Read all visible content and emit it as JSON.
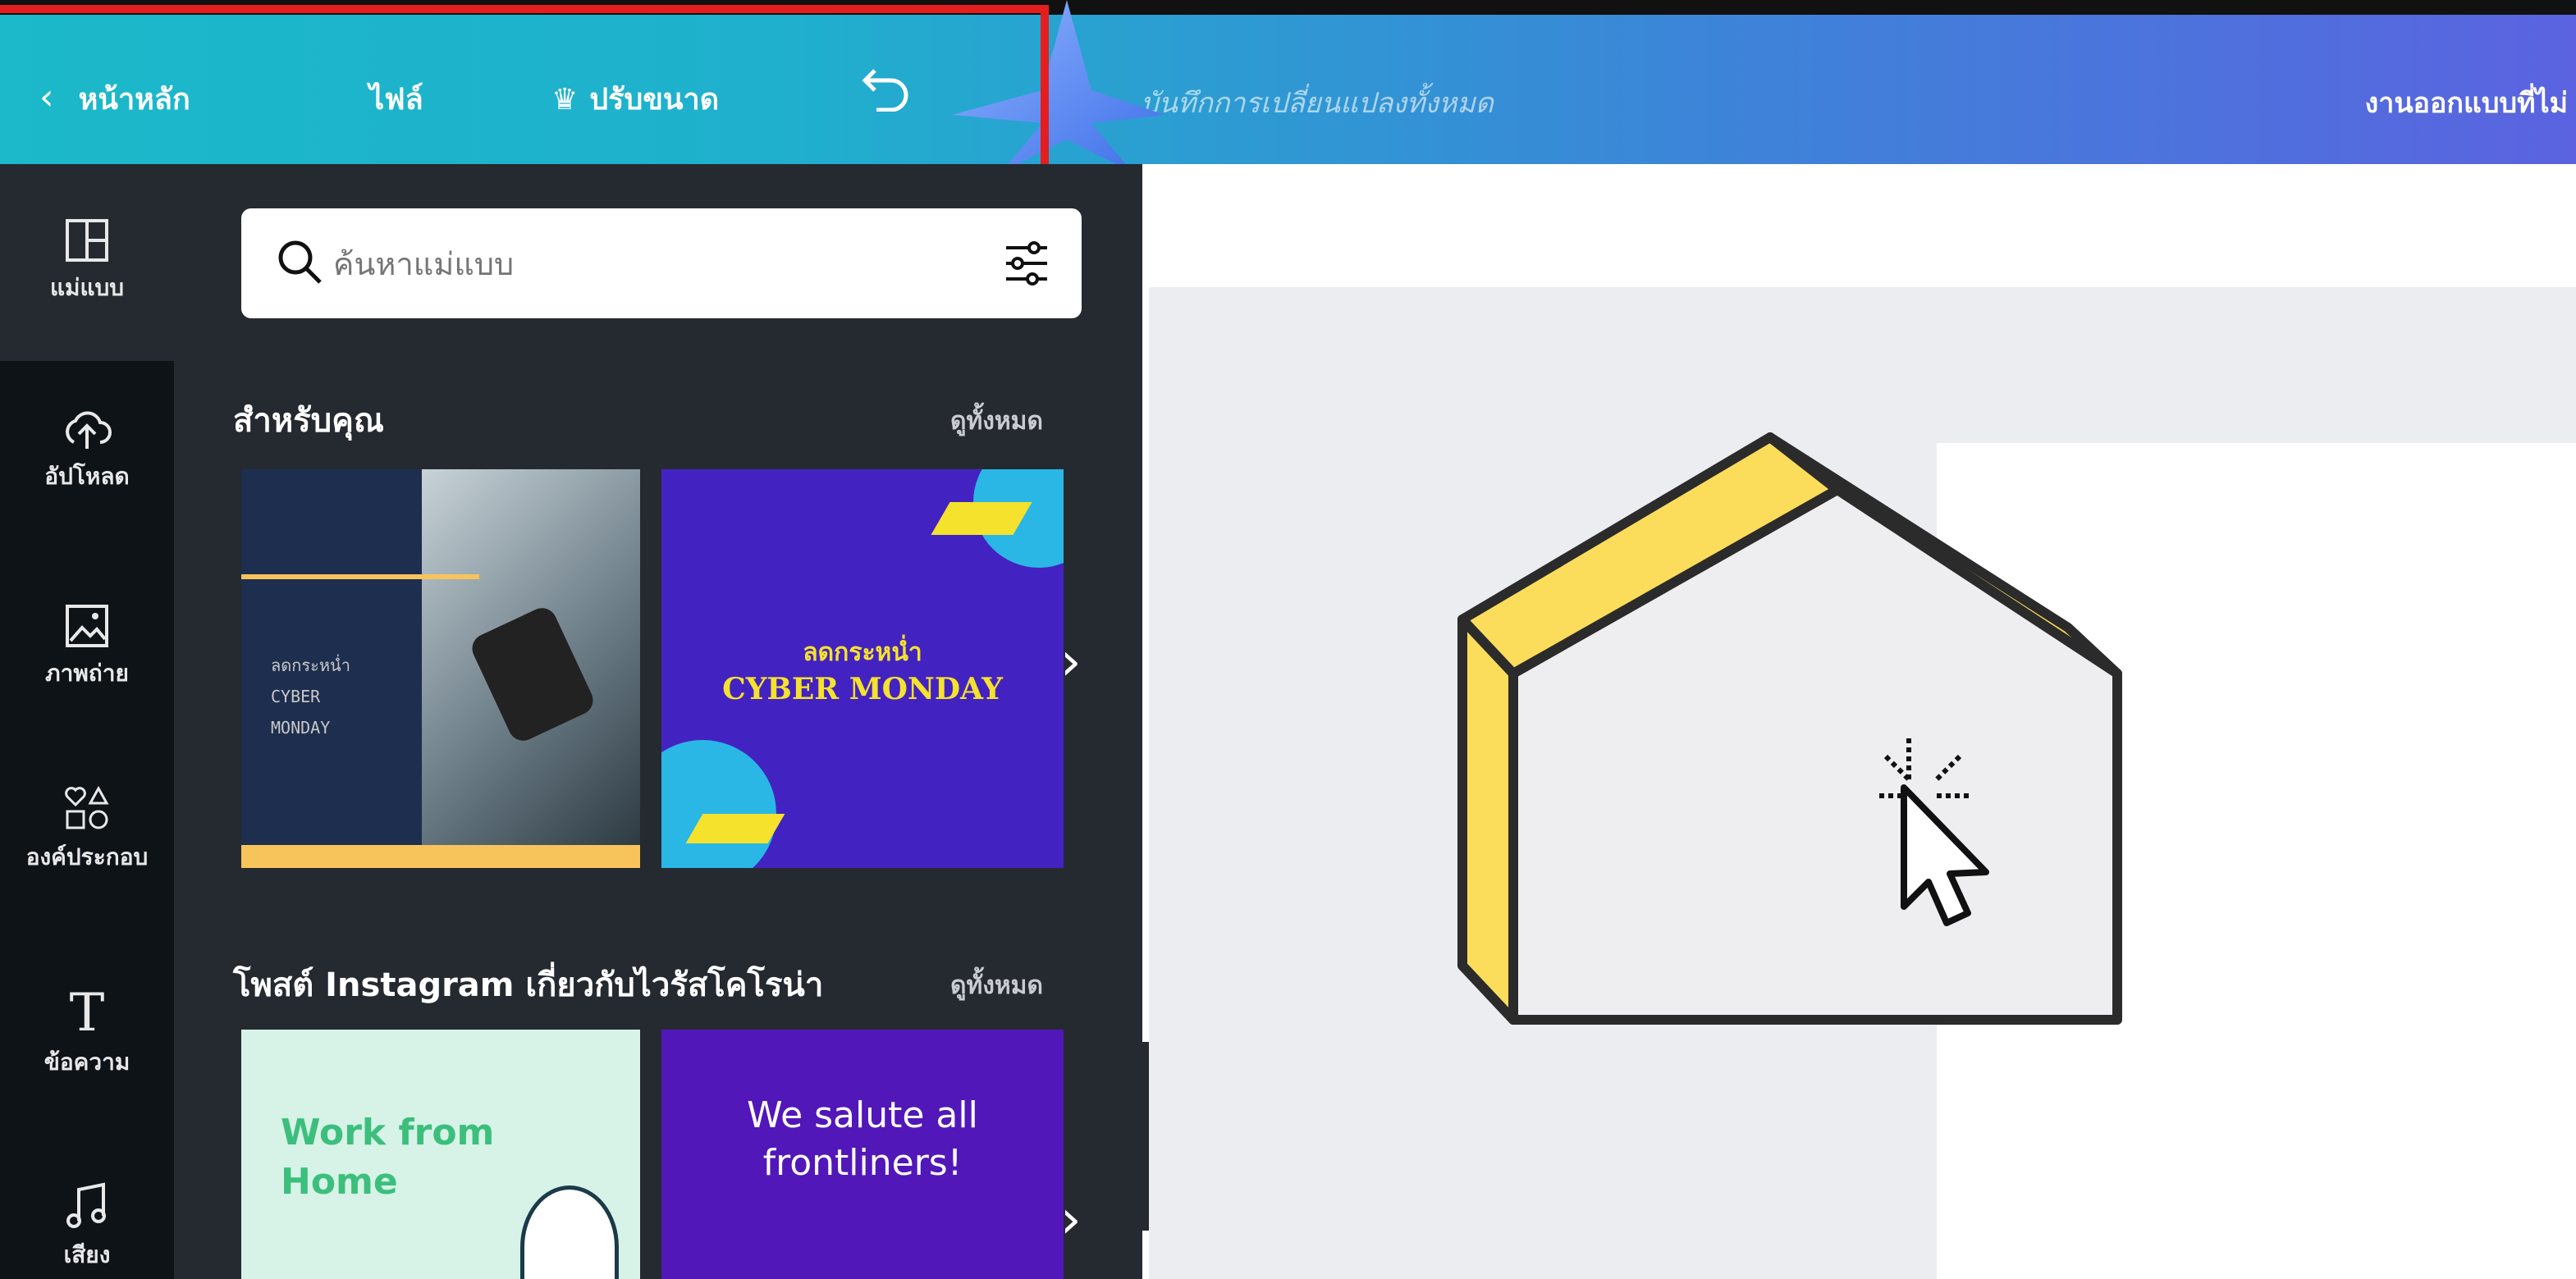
{
  "topbar": {
    "home_label": "หน้าหลัก",
    "file_label": "ไฟล์",
    "resize_label": "ปรับขนาด",
    "status_text": "บันทึกการเปลี่ยนแปลงทั้งหมด",
    "design_title": "งานออกแบบที่ไม่"
  },
  "sidebar": {
    "items": [
      {
        "label": "แม่แบบ",
        "icon": "layout-icon"
      },
      {
        "label": "อัปโหลด",
        "icon": "upload-cloud-icon"
      },
      {
        "label": "ภาพถ่าย",
        "icon": "image-icon"
      },
      {
        "label": "องค์ประกอบ",
        "icon": "shapes-icon"
      },
      {
        "label": "ข้อความ",
        "icon": "text-icon"
      },
      {
        "label": "เสียง",
        "icon": "music-note-icon"
      }
    ]
  },
  "panel": {
    "search_placeholder": "ค้นหาแม่แบบ",
    "sections": [
      {
        "title": "สำหรับคุณ",
        "see_all": "ดูทั้งหมด",
        "cards": [
          {
            "lines": [
              "ลดกระหน่ำ",
              "CYBER",
              "MONDAY"
            ]
          },
          {
            "lines": [
              "ลดกระหน่ำ",
              "CYBER MONDAY"
            ]
          }
        ]
      },
      {
        "title": "โพสต์ Instagram เกี่ยวกับไวรัสโคโรน่า",
        "see_all": "ดูทั้งหมด",
        "cards": [
          {
            "lines": [
              "Work from",
              "Home"
            ]
          },
          {
            "lines": [
              "We salute all",
              "frontliners!"
            ]
          }
        ]
      }
    ]
  },
  "colors": {
    "topbar_start": "#1bb9c9",
    "topbar_end": "#5b63e0",
    "highlight": "#e41e1e",
    "house_fill": "#eeeef0",
    "house_accent": "#fbdd5b"
  }
}
